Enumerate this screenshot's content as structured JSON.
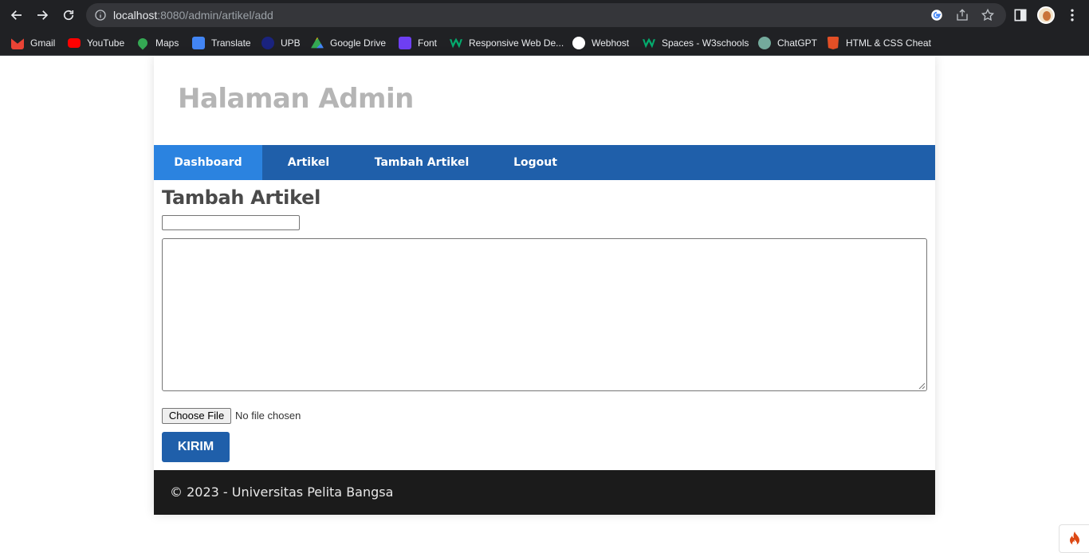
{
  "browser": {
    "url_host": "localhost",
    "url_path": ":8080/admin/artikel/add",
    "bookmarks": [
      {
        "label": "Gmail",
        "icon": "gmail-icon",
        "color": "#ea4335"
      },
      {
        "label": "YouTube",
        "icon": "youtube-icon",
        "color": "#ff0000"
      },
      {
        "label": "Maps",
        "icon": "maps-icon",
        "color": "#34a853"
      },
      {
        "label": "Translate",
        "icon": "translate-icon",
        "color": "#4285f4"
      },
      {
        "label": "UPB",
        "icon": "upb-icon",
        "color": "#1a237e"
      },
      {
        "label": "Google Drive",
        "icon": "drive-icon",
        "color": "#fbbc04"
      },
      {
        "label": "Font",
        "icon": "font-icon",
        "color": "#6e3ff3"
      },
      {
        "label": "Responsive Web De...",
        "icon": "w3schools-icon",
        "color": "#04aa6d"
      },
      {
        "label": "Webhost",
        "icon": "webhost-icon",
        "color": "#ffffff"
      },
      {
        "label": "Spaces - W3schools",
        "icon": "w3schools-icon",
        "color": "#04aa6d"
      },
      {
        "label": "ChatGPT",
        "icon": "chatgpt-icon",
        "color": "#74aa9c"
      },
      {
        "label": "HTML & CSS Cheat",
        "icon": "html5-icon",
        "color": "#e34f26"
      }
    ]
  },
  "site": {
    "title": "Halaman Admin",
    "nav": [
      "Dashboard",
      "Artikel",
      "Tambah Artikel",
      "Logout"
    ],
    "active_nav": "Dashboard"
  },
  "form": {
    "heading": "Tambah Artikel",
    "title_value": "",
    "body_value": "",
    "file_button": "Choose File",
    "file_status": "No file chosen",
    "submit_label": "KIRIM"
  },
  "footer": {
    "text": "© 2023 - Universitas Pelita Bangsa"
  },
  "colors": {
    "nav_bg": "#1f5faa",
    "nav_active": "#2b83e0",
    "footer_bg": "#1b1b1b",
    "title_color": "#b5b5b5"
  }
}
